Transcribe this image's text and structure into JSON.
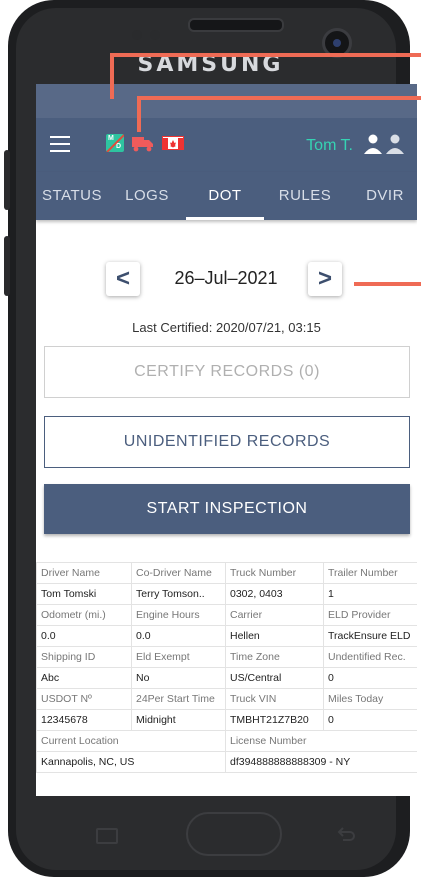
{
  "device": {
    "brand": "SAMSUNG"
  },
  "header": {
    "user_name": "Tom T."
  },
  "tabs": [
    {
      "label": "STATUS"
    },
    {
      "label": "LOGS"
    },
    {
      "label": "DOT"
    },
    {
      "label": "RULES"
    },
    {
      "label": "DVIR"
    }
  ],
  "date_nav": {
    "date": "26–Jul–2021",
    "prev": "<",
    "next": ">"
  },
  "last_certified": "Last Certified: 2020/07/21, 03:15",
  "buttons": {
    "certify": "CERTIFY RECORDS (0)",
    "unidentified": "UNIDENTIFIED RECORDS",
    "start_inspection": "START INSPECTION"
  },
  "info_table": {
    "rows": [
      [
        "Driver Name",
        "Co-Driver Name",
        "Truck Number",
        "Trailer Number"
      ],
      [
        "Tom Tomski",
        "Terry Tomson..",
        "0302, 0403",
        "1"
      ],
      [
        "Odometr (mi.)",
        "Engine Hours",
        "Carrier",
        "ELD Provider"
      ],
      [
        "0.0",
        "0.0",
        "Hellen",
        "TrackEnsure ELD"
      ],
      [
        "Shipping ID",
        "Eld Exempt",
        "Time Zone",
        "Undentified Rec."
      ],
      [
        "Abc",
        "No",
        "US/Central",
        "0"
      ],
      [
        "USDOT Nº",
        "24Per Start Time",
        "Truck VIN",
        "Miles Today"
      ],
      [
        "12345678",
        "Midnight",
        "TMBHT21Z7B20",
        "0"
      ],
      [
        "Current Location",
        "",
        "License Number",
        ""
      ],
      [
        "Kannapolis, NC, US",
        "",
        "df394888888888309 - NY",
        ""
      ]
    ]
  },
  "colors": {
    "primary": "#4b5e7e",
    "accent": "#35d3b3",
    "callout": "#ef6b55"
  }
}
